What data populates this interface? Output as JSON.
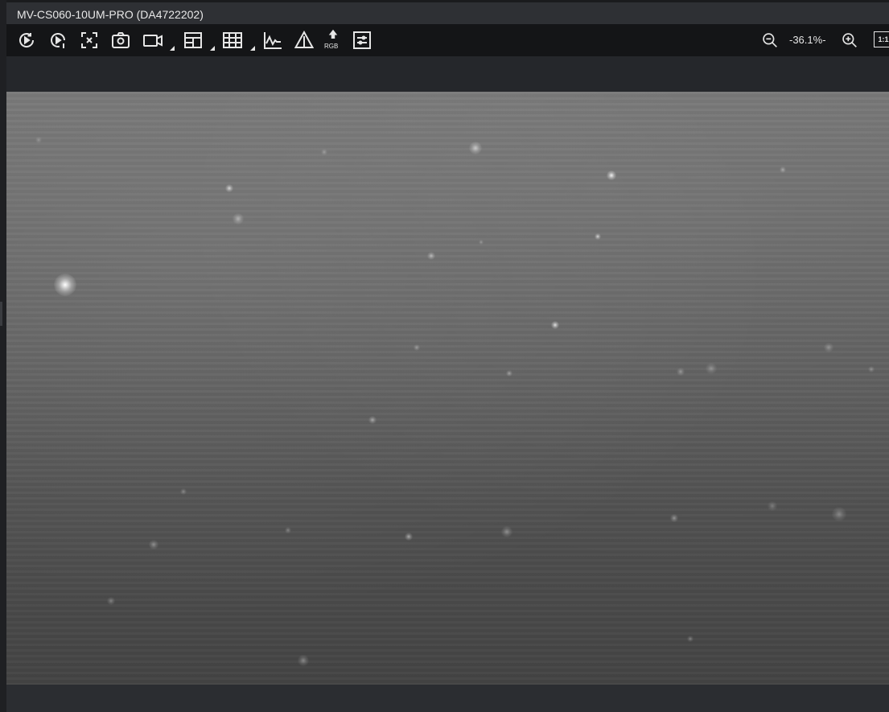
{
  "window": {
    "title": "MV-CS060-10UM-PRO (DA4722202)"
  },
  "toolbar": {
    "buttons": [
      {
        "name": "continuous-acquisition-button",
        "icon": "rotate-play-icon"
      },
      {
        "name": "single-frame-button",
        "icon": "play-single-icon"
      },
      {
        "name": "stop-acquisition-button",
        "icon": "stop-x-icon"
      },
      {
        "name": "snapshot-button",
        "icon": "camera-icon"
      },
      {
        "name": "record-button",
        "icon": "video-camera-icon",
        "dropdown": true
      },
      {
        "name": "window-layout-button",
        "icon": "layout-grid-icon",
        "dropdown": true
      },
      {
        "name": "grid-overlay-button",
        "icon": "grid-icon",
        "dropdown": true
      },
      {
        "name": "histogram-button",
        "icon": "line-chart-icon"
      },
      {
        "name": "warning-button",
        "icon": "warning-triangle-icon"
      },
      {
        "name": "rgb-button",
        "icon": "rgb-arrow-icon",
        "label": "RGB"
      },
      {
        "name": "settings-button",
        "icon": "sliders-icon"
      }
    ],
    "zoom": {
      "out_icon": "zoom-out-icon",
      "value": "-36.1%-",
      "in_icon": "zoom-in-icon",
      "actual_size_label": "1:1"
    }
  },
  "colors": {
    "toolbar_bg": "#141517",
    "titlebar_bg": "#2e3034",
    "panel_bg": "#25272b",
    "icon": "#e6e6e6"
  }
}
